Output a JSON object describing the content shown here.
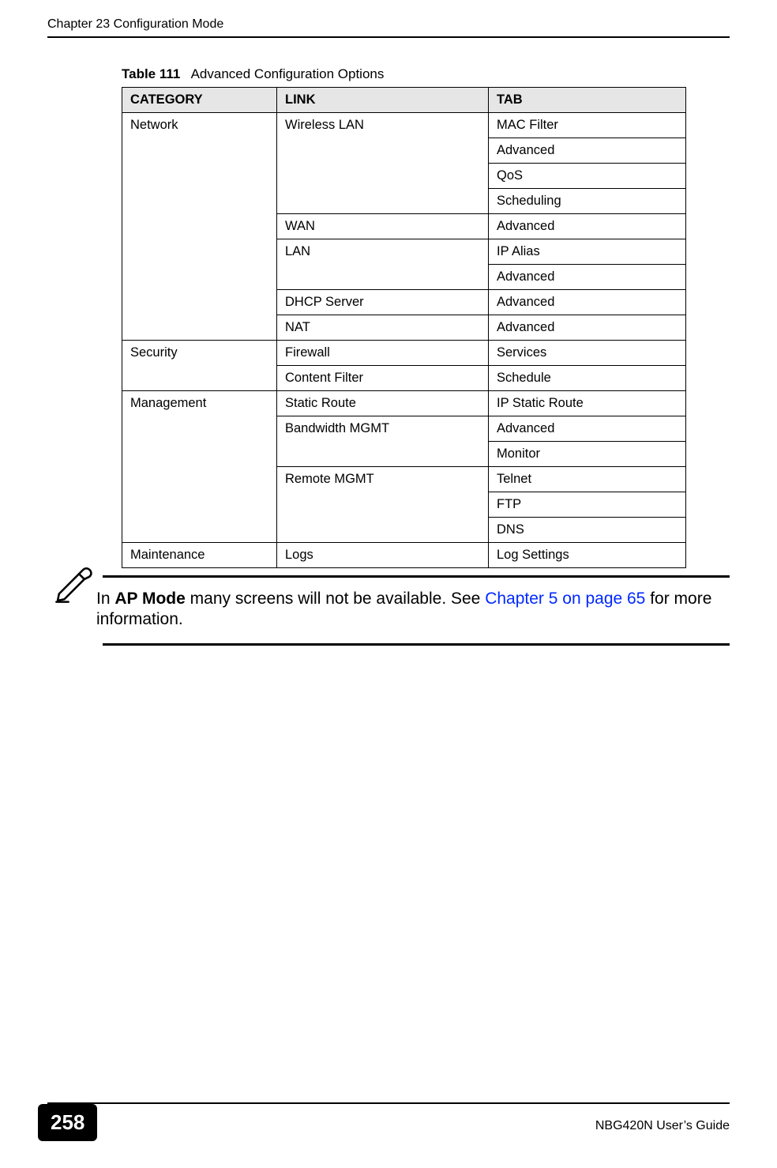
{
  "header": {
    "chapter": "Chapter 23 Configuration Mode"
  },
  "table": {
    "caption_label": "Table 111",
    "caption_text": "Advanced Configuration Options",
    "headers": {
      "c1": "CATEGORY",
      "c2": "LINK",
      "c3": "TAB"
    },
    "rows": [
      {
        "category": "Network",
        "category_rowspan": 9,
        "link": "Wireless LAN",
        "link_rowspan": 4,
        "tab": "MAC Filter"
      },
      {
        "tab": "Advanced"
      },
      {
        "tab": "QoS"
      },
      {
        "tab": "Scheduling"
      },
      {
        "link": "WAN",
        "link_rowspan": 1,
        "tab": "Advanced"
      },
      {
        "link": "LAN",
        "link_rowspan": 2,
        "tab": "IP Alias"
      },
      {
        "tab": "Advanced"
      },
      {
        "link": "DHCP Server",
        "link_rowspan": 1,
        "tab": "Advanced"
      },
      {
        "link": "NAT",
        "link_rowspan": 1,
        "tab": "Advanced"
      },
      {
        "category": "Security",
        "category_rowspan": 2,
        "link": "Firewall",
        "link_rowspan": 1,
        "tab": "Services"
      },
      {
        "link": "Content Filter",
        "link_rowspan": 1,
        "tab": "Schedule"
      },
      {
        "category": "Management",
        "category_rowspan": 6,
        "link": "Static Route",
        "link_rowspan": 1,
        "tab": "IP Static Route"
      },
      {
        "link": "Bandwidth MGMT",
        "link_rowspan": 2,
        "tab": "Advanced"
      },
      {
        "tab": "Monitor"
      },
      {
        "link": "Remote MGMT",
        "link_rowspan": 3,
        "tab": "Telnet"
      },
      {
        "tab": "FTP"
      },
      {
        "tab": "DNS"
      },
      {
        "category": "Maintenance",
        "category_rowspan": 1,
        "link": "Logs",
        "link_rowspan": 1,
        "tab": "Log Settings"
      }
    ]
  },
  "note": {
    "prefix": "In ",
    "bold": "AP Mode",
    "mid": " many screens will not be available. See ",
    "link": "Chapter 5 on page 65",
    "suffix": " for more information."
  },
  "footer": {
    "page_number": "258",
    "guide": "NBG420N User’s Guide"
  }
}
